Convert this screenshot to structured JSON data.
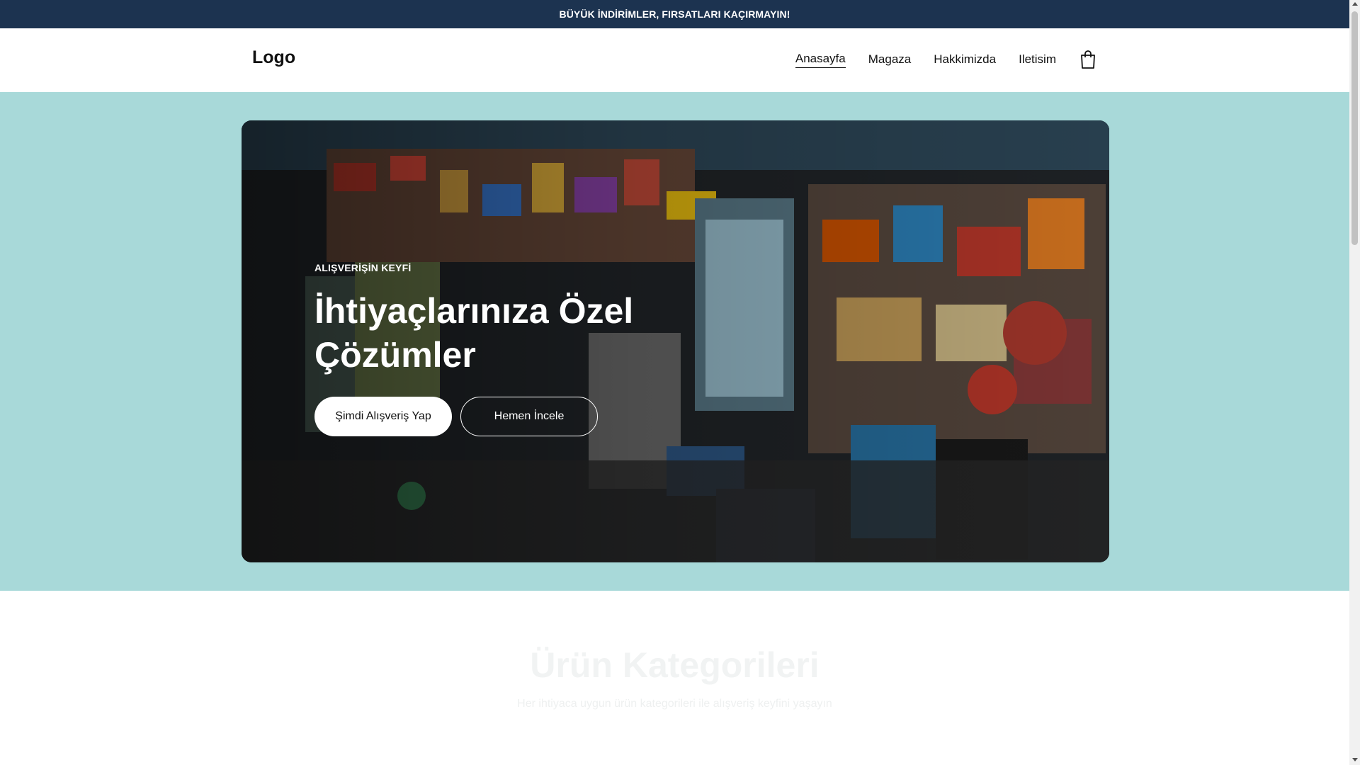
{
  "announcement": "BÜYÜK İNDİRİMLER, FIRSATLARI KAÇIRMAYIN!",
  "header": {
    "logo": "Logo",
    "nav": [
      {
        "label": "Anasayfa"
      },
      {
        "label": "Magaza"
      },
      {
        "label": "Hakkimizda"
      },
      {
        "label": "Iletisim"
      }
    ],
    "cart_icon": "shopping-bag-icon"
  },
  "hero": {
    "eyebrow": "ALIŞVERİŞİN KEYFİ",
    "title_line1": "İhtiyaçlarınıza Özel",
    "title_line2": "Çözümler",
    "primary_button": "Şimdi Alışveriş Yap",
    "secondary_button": "Hemen İncele"
  },
  "categories": {
    "title": "Ürün Kategorileri",
    "subtitle": "Her ihtiyaca uygun ürün kategorileri ile alışveriş keyfini yaşayın"
  },
  "colors": {
    "announcement_bg": "#1c3350",
    "hero_band_bg": "#a8d9d9",
    "button_primary_bg": "#ffffff"
  }
}
